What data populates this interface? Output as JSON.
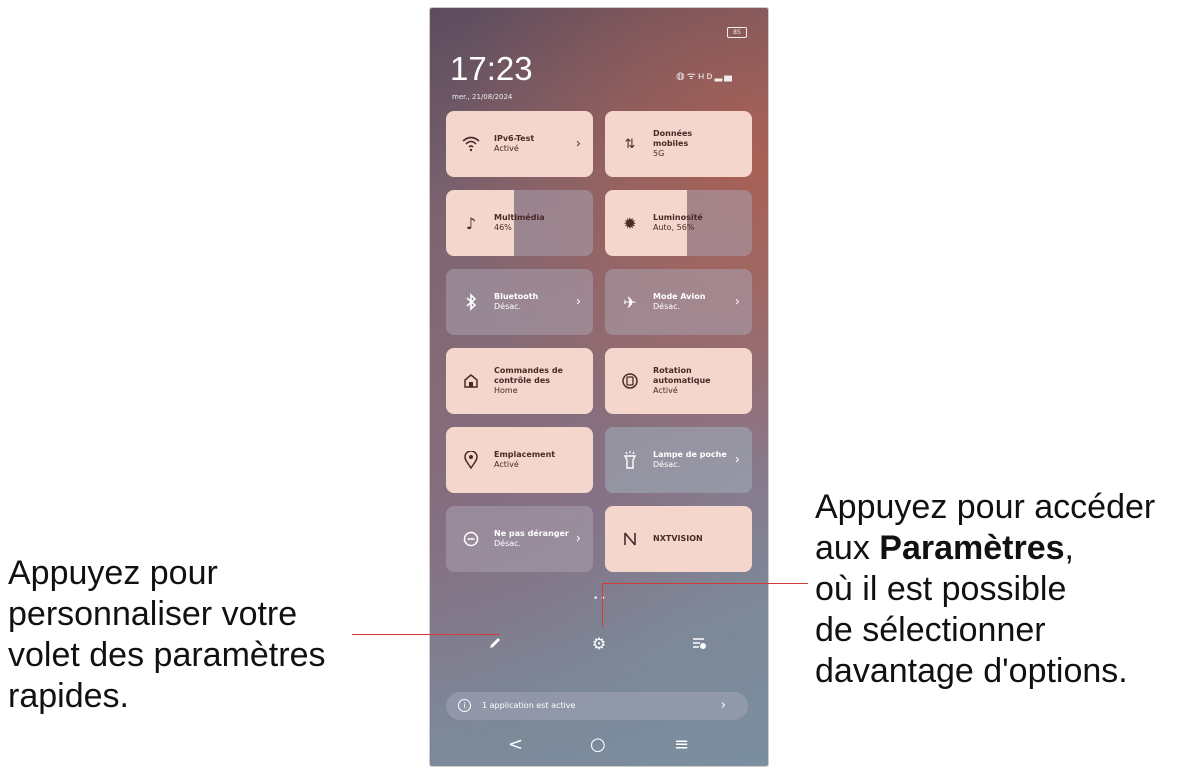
{
  "status": {
    "battery": "85",
    "time": "17:23",
    "date": "mer., 21/08/2024",
    "icons": [
      "data-saver-icon",
      "wifi-icon",
      "hd-signal-icon",
      "signal-icon"
    ]
  },
  "tiles": [
    {
      "title": "IPv6-Test",
      "sub": "Activé",
      "icon": "wifi-icon",
      "on": true,
      "chevron": true
    },
    {
      "title": "Données mobiles",
      "sub": "5G",
      "icon": "mobile-data-icon",
      "on": true,
      "chevron": false
    },
    {
      "title": "Multimédia",
      "sub": "46%",
      "icon": "music-note-icon",
      "on": true,
      "level": 0.46
    },
    {
      "title": "Luminosité",
      "sub": "Auto, 56%",
      "icon": "brightness-icon",
      "on": true,
      "level": 0.56
    },
    {
      "title": "Bluetooth",
      "sub": "Désac.",
      "icon": "bluetooth-icon",
      "on": false,
      "chevron": true
    },
    {
      "title": "Mode Avion",
      "sub": "Désac.",
      "icon": "airplane-icon",
      "on": false,
      "chevron": true
    },
    {
      "title": "Commandes de contrôle des",
      "sub": "Home",
      "icon": "home-icon",
      "on": true,
      "chevron": false
    },
    {
      "title": "Rotation automatique",
      "sub": "Activé",
      "icon": "auto-rotate-icon",
      "on": true,
      "chevron": false
    },
    {
      "title": "Emplacement",
      "sub": "Activé",
      "icon": "location-icon",
      "on": true,
      "chevron": false
    },
    {
      "title": "Lampe de poche",
      "sub": "Désac.",
      "icon": "flashlight-icon",
      "on": false,
      "chevron": true
    },
    {
      "title": "Ne pas déranger",
      "sub": "Désac.",
      "icon": "do-not-disturb-icon",
      "on": false,
      "chevron": true
    },
    {
      "title": "NXTVISION",
      "sub": "",
      "icon": "nxtvision-icon",
      "on": true,
      "chevron": false
    }
  ],
  "bottom_icons": [
    "edit-pencil-icon",
    "settings-gear-icon",
    "notification-manage-icon"
  ],
  "banner": {
    "text": "1 application est active"
  },
  "nav": {
    "back": "<",
    "home": "○",
    "menu": "≡"
  },
  "callouts": {
    "left": [
      "Appuyez pour",
      "personnaliser votre",
      "volet des paramètres",
      "rapides."
    ],
    "right_line1": "Appuyez pour accéder",
    "right_line2_pre": "aux ",
    "right_line2_bold": "Paramètres",
    "right_line2_post": ",",
    "right_line3": "où il est possible",
    "right_line4": "de sélectionner",
    "right_line5": "davantage d'options."
  },
  "colors": {
    "tile_on": "#f5d6cd",
    "tile_off": "#b3a3b4",
    "leader": "#d53a3a"
  }
}
